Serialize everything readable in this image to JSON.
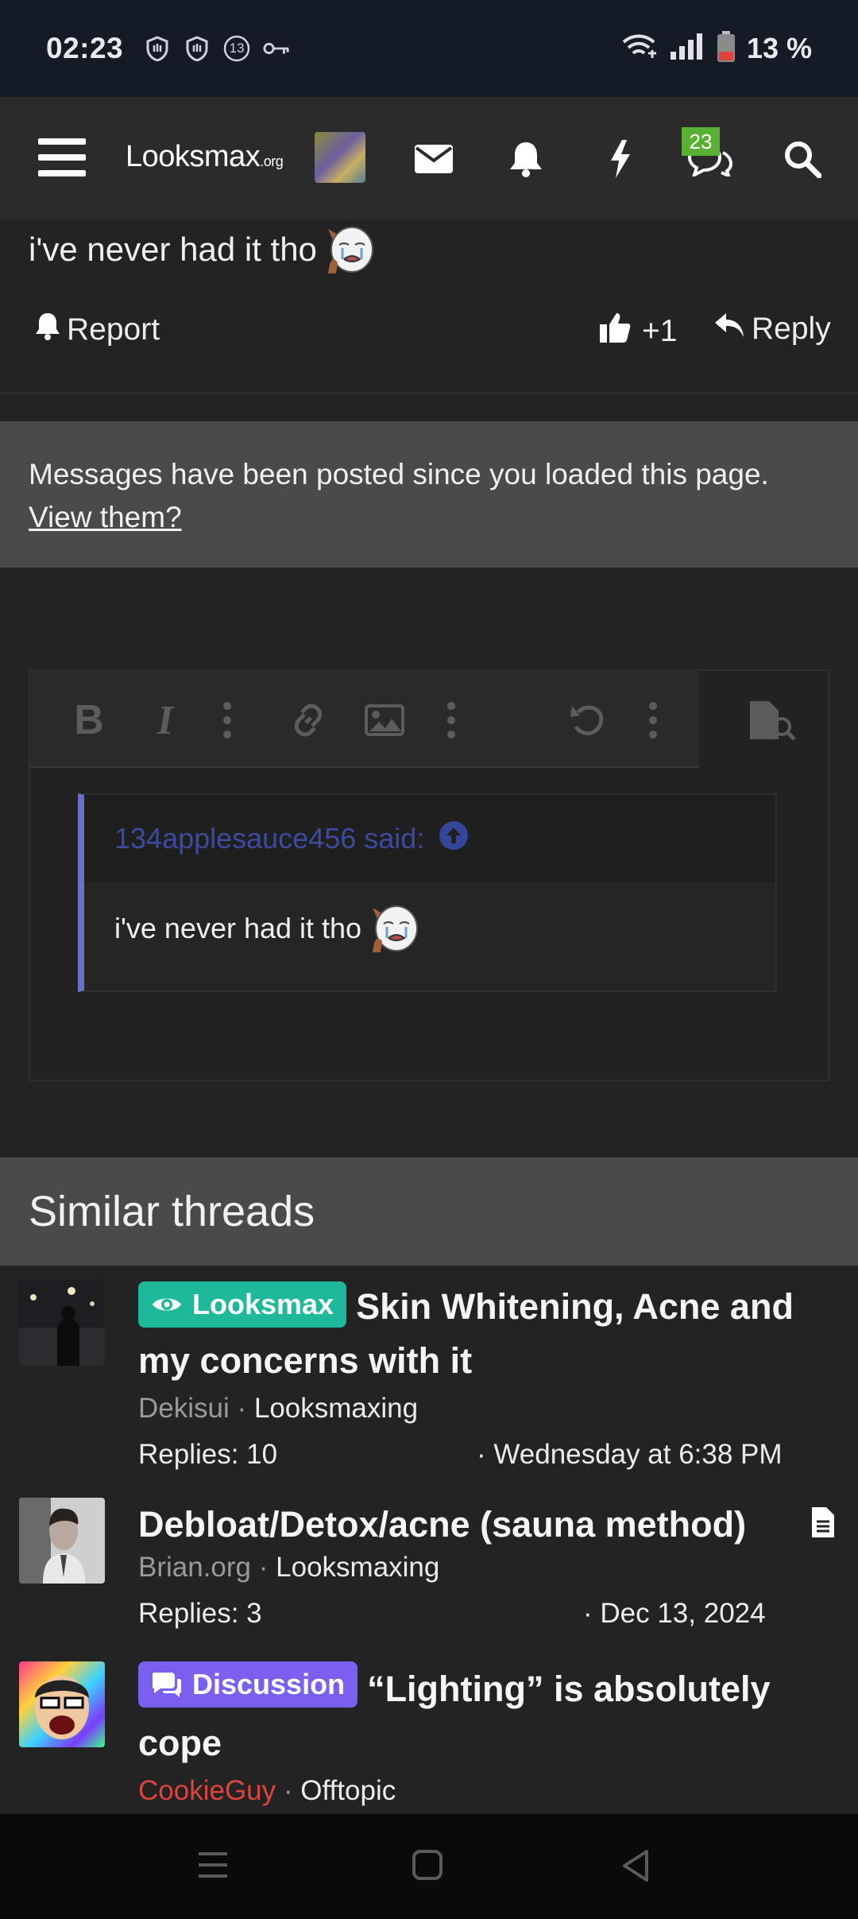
{
  "status_bar": {
    "time": "02:23",
    "notification_count": "13",
    "battery": "13 %"
  },
  "nav": {
    "logo_main": "Looksmax",
    "logo_suffix": ".org",
    "conversations_badge": "23"
  },
  "post": {
    "text": "i've never had it tho",
    "report_label": "Report",
    "like_count": "+1",
    "reply_label": "Reply"
  },
  "notice": {
    "message": "Messages have been posted since you loaded this page.",
    "link": "View them?"
  },
  "editor": {
    "quote_author": "134applesauce456 said:",
    "quote_text": "i've never had it tho"
  },
  "similar": {
    "heading": "Similar threads",
    "threads": [
      {
        "tag": "Looksmax",
        "title": "Skin Whitening, Acne and my concerns with it",
        "author": "Dekisui",
        "forum": "Looksmaxing",
        "replies": "Replies: 10",
        "date": "· Wednesday at 6:38 PM"
      },
      {
        "title": "Debloat/Detox/acne (sauna method)",
        "author": "Brian.org",
        "forum": "Looksmaxing",
        "replies": "Replies: 3",
        "date": "· Dec 13, 2024"
      },
      {
        "tag": "Discussion",
        "title": "“Lighting” is absolutely cope",
        "author": "CookieGuy",
        "forum": "Offtopic"
      }
    ]
  },
  "colors": {
    "tag_looksmax": "#1db99a",
    "tag_discussion": "#7b5ff0",
    "author_red": "#e0433b",
    "badge_green": "#59b133"
  }
}
